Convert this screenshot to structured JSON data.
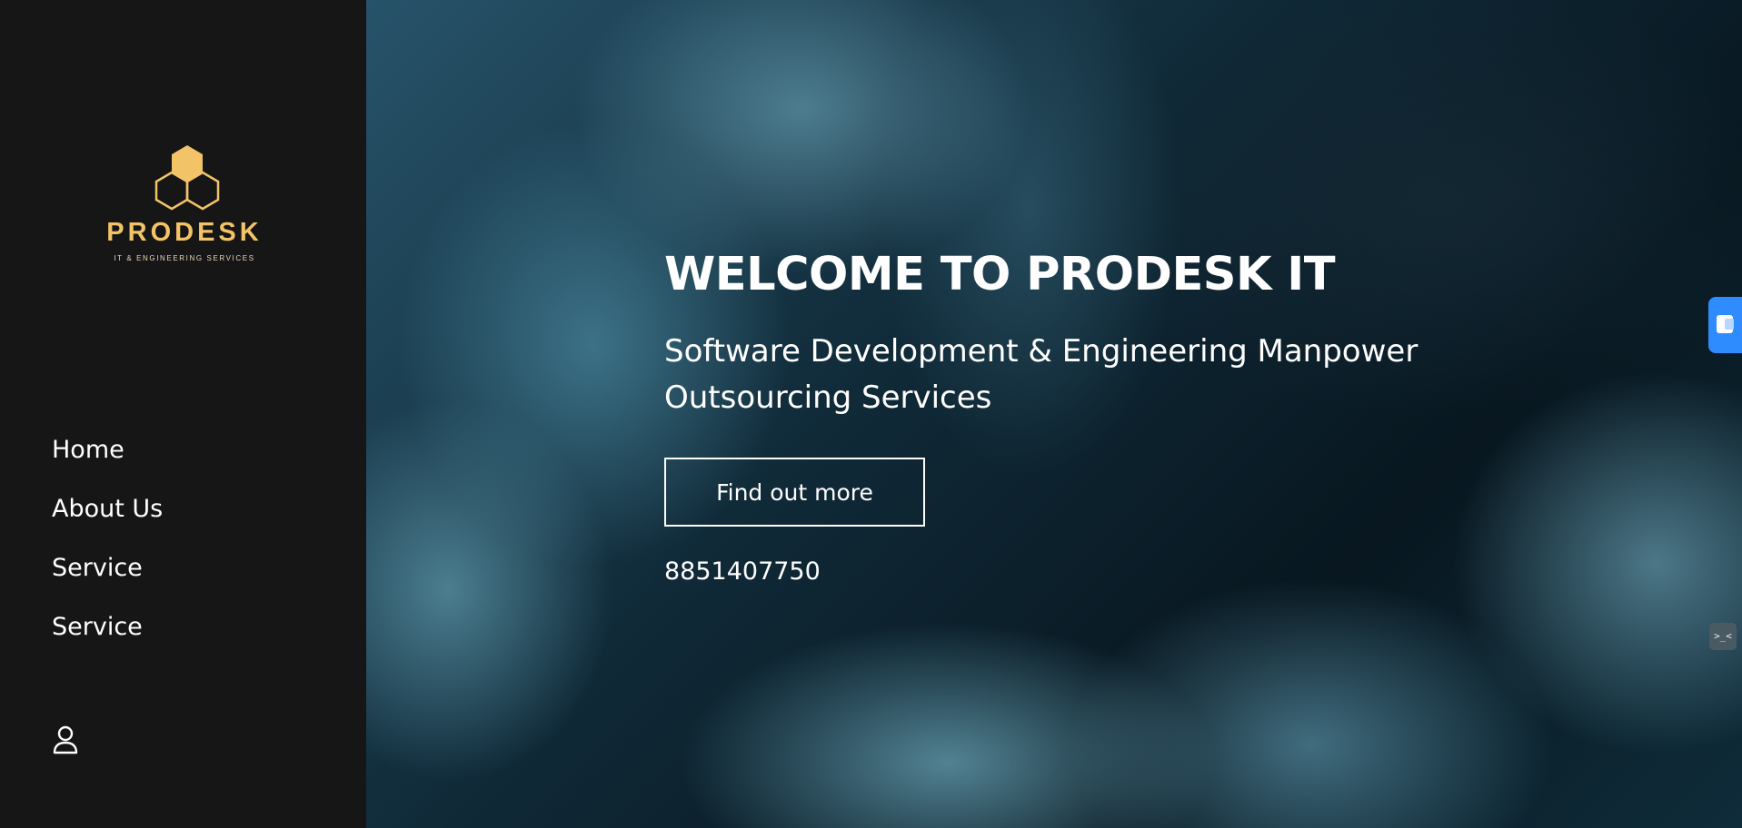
{
  "brand": {
    "name": "PRODESK",
    "tagline": "IT & ENGINEERING SERVICES",
    "icon": "hexagon-cluster-logo",
    "color": "#f3c367"
  },
  "nav": {
    "items": [
      {
        "label": "Home"
      },
      {
        "label": "About Us"
      },
      {
        "label": "Service"
      },
      {
        "label": "Service"
      }
    ],
    "account_icon": "user-icon"
  },
  "hero": {
    "title": "WELCOME TO PRODESK IT",
    "subtitle": "Software Development & Engineering Manpower Outsourcing Services",
    "cta_label": "Find out more",
    "phone": "8851407750"
  },
  "widgets": {
    "side_tab_icon": "app-widget-icon",
    "small_widget_label": ">_<",
    "side_tab_color": "#2f8cff"
  }
}
